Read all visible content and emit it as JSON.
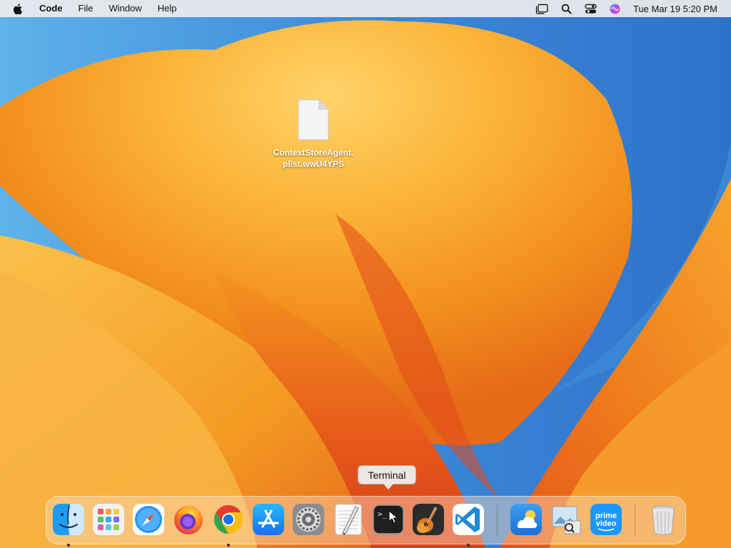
{
  "menubar": {
    "app_name": "Code",
    "items": [
      "File",
      "Window",
      "Help"
    ],
    "clock": "Tue Mar 19  5:20 PM"
  },
  "desktop": {
    "file_name": "ContextStoreAgent.plist.wwU4YPS"
  },
  "tooltip": {
    "text": "Terminal"
  },
  "dock": {
    "apps": [
      {
        "name": "Finder",
        "icon": "finder-icon",
        "running": true
      },
      {
        "name": "Launchpad",
        "icon": "launchpad-icon",
        "running": false
      },
      {
        "name": "Safari",
        "icon": "safari-icon",
        "running": false
      },
      {
        "name": "Firefox",
        "icon": "firefox-icon",
        "running": false
      },
      {
        "name": "Google Chrome",
        "icon": "chrome-icon",
        "running": true
      },
      {
        "name": "App Store",
        "icon": "app-store-icon",
        "running": false
      },
      {
        "name": "System Settings",
        "icon": "settings-gear-icon",
        "running": false
      },
      {
        "name": "TextEdit",
        "icon": "textedit-icon",
        "running": false
      },
      {
        "name": "Terminal",
        "icon": "terminal-icon",
        "running": false
      },
      {
        "name": "GarageBand",
        "icon": "garageband-guitar-icon",
        "running": false
      },
      {
        "name": "Visual Studio Code",
        "icon": "vscode-icon",
        "running": true
      },
      {
        "name": "Weather",
        "icon": "weather-icon",
        "running": false
      },
      {
        "name": "Preview",
        "icon": "preview-icon",
        "running": false
      },
      {
        "name": "Prime Video",
        "icon": "prime-video-icon",
        "running": false
      },
      {
        "name": "Trash",
        "icon": "trash-icon",
        "running": false
      }
    ],
    "prime_label_top": "prime",
    "prime_label_bottom": "video",
    "terminal_prompt": ">_"
  },
  "colors": {
    "accent_orange": "#f39a1b",
    "deep_orange": "#e8561a",
    "sky_blue": "#3f8fd8",
    "vscode_blue": "#1f8ad2",
    "appstore_blue": "#1a8cf0"
  }
}
